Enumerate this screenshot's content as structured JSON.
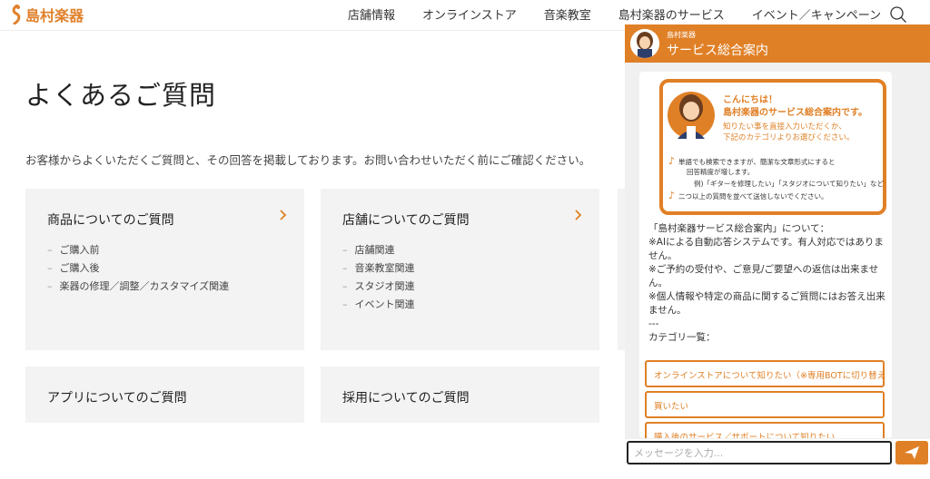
{
  "header": {
    "logo_text": "島村楽器",
    "nav": [
      "店舗情報",
      "オンラインストア",
      "音楽教室",
      "島村楽器のサービス",
      "イベント／キャンペーン"
    ]
  },
  "main": {
    "title": "よくあるご質問",
    "intro": "お客様からよくいただくご質問と、その回答を掲載しております。お問い合わせいただく前にご確認ください。",
    "categories": [
      {
        "title": "商品についてのご質問",
        "items": [
          "ご購入前",
          "ご購入後",
          "楽器の修理／調整／カスタマイズ関連"
        ]
      },
      {
        "title": "店舗についてのご質問",
        "items": [
          "店舗関連",
          "音楽教室関連",
          "スタジオ関連",
          "イベント関連"
        ]
      },
      {
        "title": "アプリについてのご質問",
        "items": []
      },
      {
        "title": "採用についてのご質問",
        "items": []
      }
    ]
  },
  "chat": {
    "header_sub": "島村楽器",
    "header_title": "サービス総合案内",
    "banner": {
      "greet1": "こんにちは！",
      "greet2": "島村楽器のサービス総合案内です。",
      "greet3": "知りたい事を直接入力いただくか、",
      "greet4": "下記のカテゴリよりお選びください。",
      "note1a": "単語でも検索できますが、簡潔な文章形式にすると",
      "note1b": "回答精度が増します。",
      "note1c": "例)「ギターを修理したい」「スタジオについて知りたい」など",
      "note2": "二つ以上の質問を並べて送信しないでください。"
    },
    "message_lines": [
      "「島村楽器サービス総合案内」について：",
      "※AIによる自動応答システムです。有人対応ではありません。",
      "※ご予約の受付や、ご意見/ご要望への返信は出来ません。",
      "※個人情報や特定の商品に関するご質問にはお答え出来ません。",
      "---",
      "カテゴリ一覧："
    ],
    "options": [
      "オンラインストアについて知りたい（※専用BOTに切り替え）",
      "買いたい",
      "購入後のサービス／サポートについて知りたい"
    ],
    "input_placeholder": "メッセージを入力...",
    "accent": "#e08026"
  }
}
